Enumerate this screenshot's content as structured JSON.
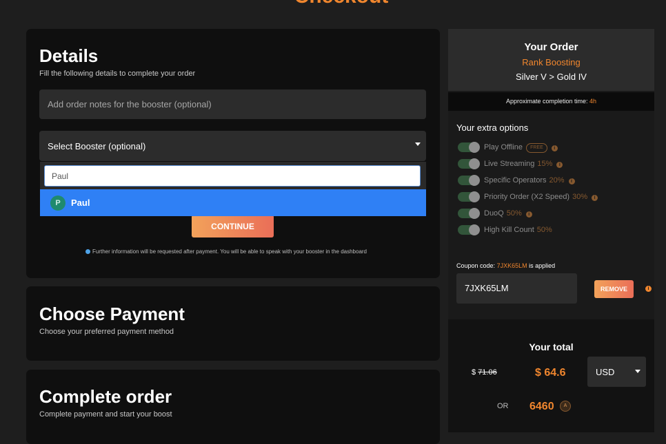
{
  "page": {
    "title": "Checkout"
  },
  "details": {
    "heading": "Details",
    "subtitle": "Fill the following details to complete your order",
    "notes_placeholder": "Add order notes for the booster (optional)",
    "booster_select_label": "Select Booster (optional)",
    "search_value": "Paul",
    "option": {
      "initial": "P",
      "name": "Paul"
    },
    "continue_label": "CONTINUE",
    "info_note": "Further information will be requested after payment. You will be able to speak with your booster in the dashboard"
  },
  "payment": {
    "heading": "Choose Payment",
    "subtitle": "Choose your preferred payment method"
  },
  "complete": {
    "heading": "Complete order",
    "subtitle": "Complete payment and start your boost"
  },
  "order": {
    "title": "Your Order",
    "service": "Rank Boosting",
    "ranks": "Silver V > Gold IV",
    "completion_label": "Approximate completion time:",
    "completion_value": "4h"
  },
  "extras": {
    "title": "Your extra options",
    "items": [
      {
        "name": "Play Offline",
        "badge": "FREE",
        "pct": "",
        "info": true
      },
      {
        "name": "Live Streaming",
        "badge": "",
        "pct": "15%",
        "info": true
      },
      {
        "name": "Specific Operators",
        "badge": "",
        "pct": "20%",
        "info": true
      },
      {
        "name": "Priority Order (X2 Speed)",
        "badge": "",
        "pct": "30%",
        "info": true
      },
      {
        "name": "DuoQ",
        "badge": "",
        "pct": "50%",
        "info": true
      },
      {
        "name": "High Kill Count",
        "badge": "",
        "pct": "50%",
        "info": false
      }
    ]
  },
  "coupon": {
    "label_prefix": "Coupon code:",
    "code": "7JXK65LM",
    "label_suffix": "is applied",
    "value": "7JXK65LM",
    "remove_label": "REMOVE"
  },
  "total": {
    "title": "Your total",
    "old_currency": "$",
    "old_amount": "71.06",
    "new_price": "$ 64.6",
    "currency": "USD",
    "or_label": "OR",
    "points": "6460",
    "points_icon_text": "A"
  },
  "colors": {
    "accent": "#f0862e",
    "option_highlight": "#2f80f5",
    "toggle_on": "#32553a"
  }
}
